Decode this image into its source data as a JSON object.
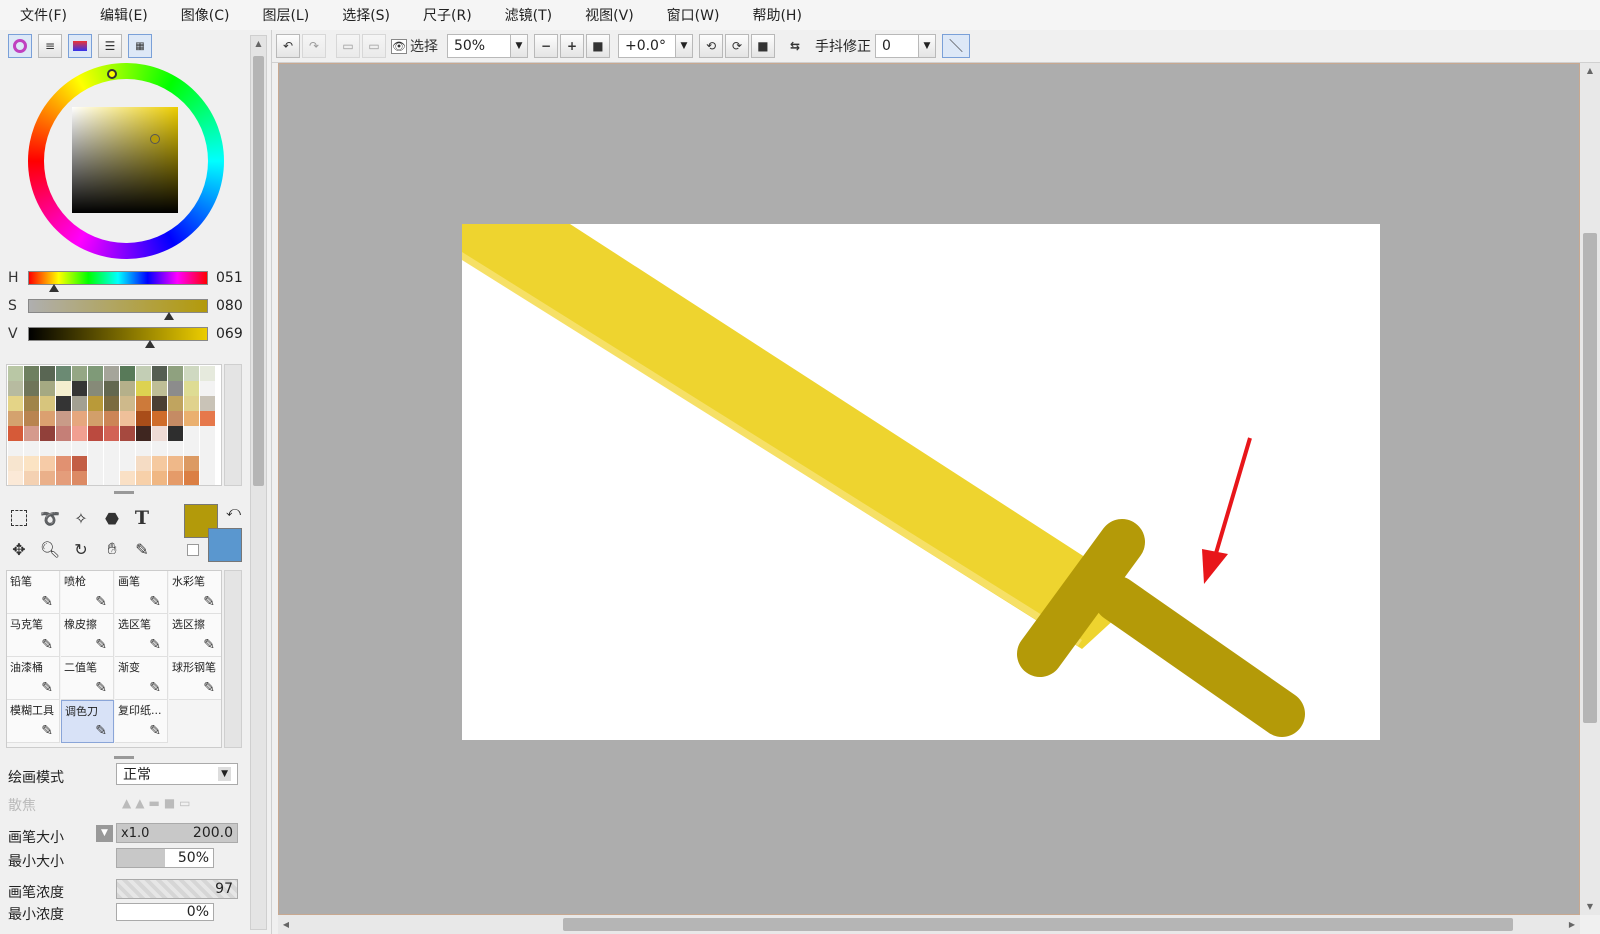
{
  "menu": [
    "文件(F)",
    "编辑(E)",
    "图像(C)",
    "图层(L)",
    "选择(S)",
    "尺子(R)",
    "滤镜(T)",
    "视图(V)",
    "窗口(W)",
    "帮助(H)"
  ],
  "toolbar": {
    "select_label": "选择",
    "zoom": "50%",
    "rotation": "+0.0°",
    "stabilizer_label": "手抖修正",
    "stabilizer_value": "0"
  },
  "color": {
    "h_label": "H",
    "h_value": "051",
    "s_label": "S",
    "s_value": "080",
    "v_label": "V",
    "v_value": "069",
    "primary": "#b39a0a",
    "secondary": "#5a97cf",
    "blade": "#eed42f",
    "guard": "#b49a08"
  },
  "palette_colors": [
    [
      "#b9c7a5",
      "#6e8060",
      "#596653",
      "#6b8a73",
      "#95a785",
      "#7f9a78",
      "#a5a59a",
      "#587a59",
      "#c3ceb5",
      "#555e52",
      "#8fa17f",
      "#cfd9c1",
      "#e6eadd"
    ],
    [
      "#b7bba0",
      "#6f7559",
      "#a5a982",
      "#f4efcf",
      "#353535",
      "#868a78",
      "#63684f",
      "#b5b08a",
      "#ddd251",
      "#bfbe96",
      "#8c8c8c",
      "#dedc93",
      "#f3f3f3"
    ],
    [
      "#e4d487",
      "#a08449",
      "#d7c57d",
      "#343434",
      "#a3a092",
      "#b99a39",
      "#7b6c40",
      "#ceb98b",
      "#cd7a3a",
      "#4b3f33",
      "#c0a45f",
      "#e0d28d",
      "#c9c3b7"
    ],
    [
      "#d4a26e",
      "#b98450",
      "#dba070",
      "#c99b88",
      "#e6a77e",
      "#d29f6a",
      "#cc8556",
      "#efc09a",
      "#a94d19",
      "#cf6c2a",
      "#c58b64",
      "#eab06f",
      "#e6784b"
    ],
    [
      "#d65a38",
      "#d59a8d",
      "#91403a",
      "#c57f77",
      "#f19f91",
      "#bb4a3f",
      "#d26355",
      "#a6493f",
      "#3f2620",
      "#eedbd5",
      "#2e2e2e",
      "#f2f2f2",
      "#f2f2f2"
    ],
    [
      "#f2f2f2",
      "#f2f2f2",
      "#f2f2f2",
      "#f2f2f2",
      "#f2f2f2",
      "#f2f2f2",
      "#f2f2f2",
      "#f2f2f2",
      "#f2f2f2",
      "#f2f2f2",
      "#f2f2f2",
      "#f2f2f2",
      "#f2f2f2"
    ],
    [
      "#f7e5cf",
      "#fbe3c3",
      "#f6cba7",
      "#e19171",
      "#c35e45",
      "#f2f2f2",
      "#f2f2f2",
      "#f2f2f2",
      "#f5dcc4",
      "#f5c99f",
      "#efb889",
      "#dc9a63",
      "#f2f2f2"
    ],
    [
      "#fbe9d7",
      "#f4d1b2",
      "#eab08a",
      "#e49d7b",
      "#dc8a64",
      "#f2f2f2",
      "#f2f2f2",
      "#fae0c5",
      "#f7d0a9",
      "#f0b783",
      "#e59b69",
      "#db7f44",
      "#f2f2f2"
    ]
  ],
  "brushes": [
    {
      "label": "铅笔",
      "icon": "pencil-icon"
    },
    {
      "label": "喷枪",
      "icon": "airbrush-icon"
    },
    {
      "label": "画笔",
      "icon": "brush-icon"
    },
    {
      "label": "水彩笔",
      "icon": "watercolor-icon"
    },
    {
      "label": "马克笔",
      "icon": "marker-icon"
    },
    {
      "label": "橡皮擦",
      "icon": "eraser-icon"
    },
    {
      "label": "选区笔",
      "icon": "selection-pen-icon"
    },
    {
      "label": "选区擦",
      "icon": "selection-eraser-icon"
    },
    {
      "label": "油漆桶",
      "icon": "bucket-icon"
    },
    {
      "label": "二值笔",
      "icon": "binary-pen-icon"
    },
    {
      "label": "渐变",
      "icon": "gradient-icon"
    },
    {
      "label": "球形钢笔",
      "icon": "ball-pen-icon"
    },
    {
      "label": "模糊工具",
      "icon": "blur-icon"
    },
    {
      "label": "调色刀",
      "icon": "palette-knife-icon"
    },
    {
      "label": "复印纸...",
      "icon": "copy-paper-icon"
    }
  ],
  "props": {
    "draw_mode_label": "绘画模式",
    "draw_mode_value": "正常",
    "scatter_label": "散焦",
    "brush_size_label": "画笔大小",
    "brush_size_mult": "x1.0",
    "brush_size_value": "200.0",
    "min_size_label": "最小大小",
    "min_size_value": "50%",
    "density_label": "画笔浓度",
    "density_value": "97",
    "min_density_label": "最小浓度",
    "min_density_value": "0%"
  }
}
